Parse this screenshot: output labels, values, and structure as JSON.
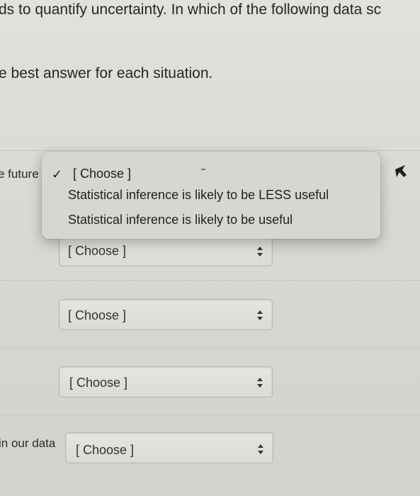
{
  "question": {
    "line1": "ds to quantify uncertainty. In which of the following data sc",
    "line2": "e best answer for each situation."
  },
  "rows": [
    {
      "label": "e future",
      "value": "[ Choose ]"
    },
    {
      "label": "",
      "value": "[ Choose ]"
    },
    {
      "label": "",
      "value": "[ Choose ]"
    },
    {
      "label": "in our data",
      "value": "[ Choose ]"
    }
  ],
  "dropdown": {
    "options": [
      "[ Choose ]",
      "Statistical inference is likely to be LESS useful",
      "Statistical inference is likely to be useful"
    ],
    "selected_index": 0
  },
  "icons": {
    "check": "checkmark-icon",
    "select_arrows": "up-down-arrows-icon",
    "cursor": "mouse-pointer-icon"
  }
}
